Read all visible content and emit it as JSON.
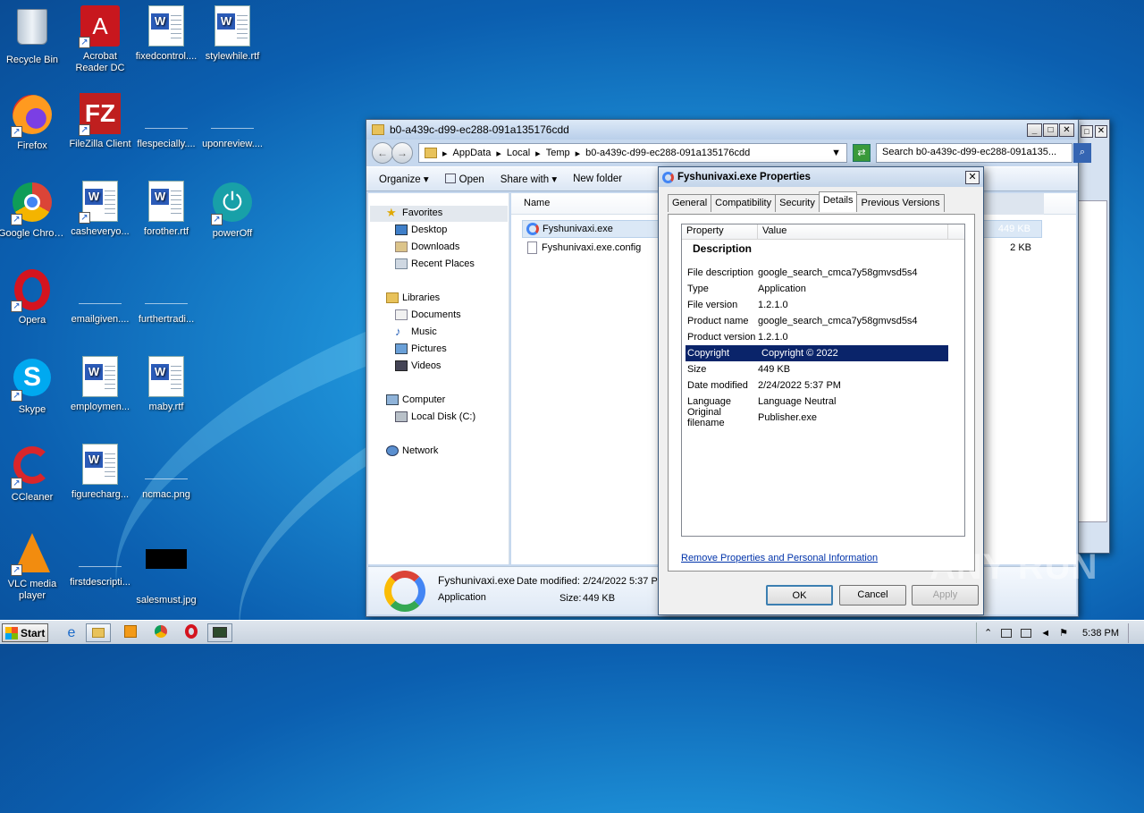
{
  "desktop": {
    "icons": [
      {
        "label": "Recycle Bin"
      },
      {
        "label": "Acrobat Reader DC"
      },
      {
        "label": "fixedcontrol...."
      },
      {
        "label": "stylewhile.rtf"
      },
      {
        "label": "Firefox"
      },
      {
        "label": "FileZilla Client"
      },
      {
        "label": "flespecially...."
      },
      {
        "label": "uponreview...."
      },
      {
        "label": "Google Chrome"
      },
      {
        "label": "casheveryo..."
      },
      {
        "label": "forother.rtf"
      },
      {
        "label": "powerOff"
      },
      {
        "label": "Opera"
      },
      {
        "label": "emailgiven...."
      },
      {
        "label": "furthertradi..."
      },
      {
        "label": "Skype"
      },
      {
        "label": "employmen..."
      },
      {
        "label": "maby.rtf"
      },
      {
        "label": "CCleaner"
      },
      {
        "label": "figurecharg..."
      },
      {
        "label": "ncmac.png"
      },
      {
        "label": "VLC media player"
      },
      {
        "label": "firstdescripti..."
      },
      {
        "label": "salesmust.jpg"
      }
    ]
  },
  "explorer": {
    "title": "b0-a439c-d99-ec288-091a135176cdd",
    "breadcrumb": [
      "AppData",
      "Local",
      "Temp",
      "b0-a439c-d99-ec288-091a135176cdd"
    ],
    "search_placeholder": "Search b0-a439c-d99-ec288-091a135...",
    "commands": {
      "organize": "Organize",
      "open": "Open",
      "share": "Share with",
      "new_folder": "New folder"
    },
    "nav": {
      "favorites": "Favorites",
      "desktop": "Desktop",
      "downloads": "Downloads",
      "recent": "Recent Places",
      "libraries": "Libraries",
      "documents": "Documents",
      "music": "Music",
      "pictures": "Pictures",
      "videos": "Videos",
      "computer": "Computer",
      "local_disk": "Local Disk (C:)",
      "network": "Network"
    },
    "columns": {
      "name": "Name"
    },
    "files": [
      {
        "name": "Fyshunivaxi.exe",
        "size": "449 KB"
      },
      {
        "name": "Fyshunivaxi.exe.config",
        "size": "2 KB"
      }
    ],
    "details": {
      "filename": "Fyshunivaxi.exe",
      "type": "Application",
      "modified_label": "Date modified:",
      "modified_value": "2/24/2022 5:37 P",
      "size_label": "Size:",
      "size_value": "449 KB"
    }
  },
  "properties": {
    "title": "Fyshunivaxi.exe Properties",
    "tabs": [
      "General",
      "Compatibility",
      "Security",
      "Details",
      "Previous Versions"
    ],
    "header": {
      "property": "Property",
      "value": "Value"
    },
    "section": "Description",
    "rows": [
      {
        "k": "File description",
        "v": "google_search_cmca7y58gmvsd5s4"
      },
      {
        "k": "Type",
        "v": "Application"
      },
      {
        "k": "File version",
        "v": "1.2.1.0"
      },
      {
        "k": "Product name",
        "v": "google_search_cmca7y58gmvsd5s4"
      },
      {
        "k": "Product version",
        "v": "1.2.1.0"
      },
      {
        "k": "Copyright",
        "v": "Copyright ©  2022"
      },
      {
        "k": "Size",
        "v": "449 KB"
      },
      {
        "k": "Date modified",
        "v": "2/24/2022 5:37 PM"
      },
      {
        "k": "Language",
        "v": "Language Neutral"
      },
      {
        "k": "Original filename",
        "v": "Publisher.exe"
      }
    ],
    "link": "Remove Properties and Personal Information",
    "buttons": {
      "ok": "OK",
      "cancel": "Cancel",
      "apply": "Apply"
    }
  },
  "taskbar": {
    "start": "Start",
    "clock": "5:38 PM"
  },
  "watermark": "ANY RUN"
}
